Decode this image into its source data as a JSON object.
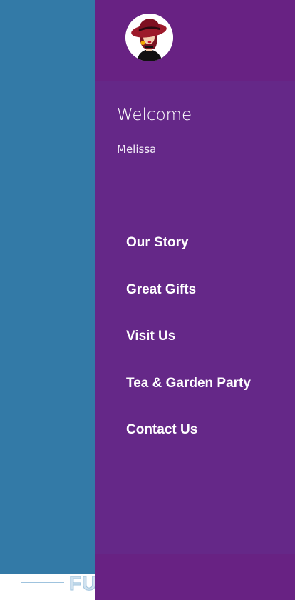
{
  "background": {
    "footer_text": "FU"
  },
  "drawer": {
    "avatar_icon": "woman-red-hat-icon",
    "welcome": "Welcome",
    "username": "Melissa",
    "menu": [
      {
        "label": "Our Story"
      },
      {
        "label": "Great Gifts"
      },
      {
        "label": "Visit Us"
      },
      {
        "label": "Tea & Garden Party"
      },
      {
        "label": "Contact Us"
      }
    ]
  },
  "colors": {
    "drawer_bg": "#652888",
    "drawer_header_bg": "#682283",
    "background_panel": "#337aa7",
    "text": "#ffffff"
  }
}
